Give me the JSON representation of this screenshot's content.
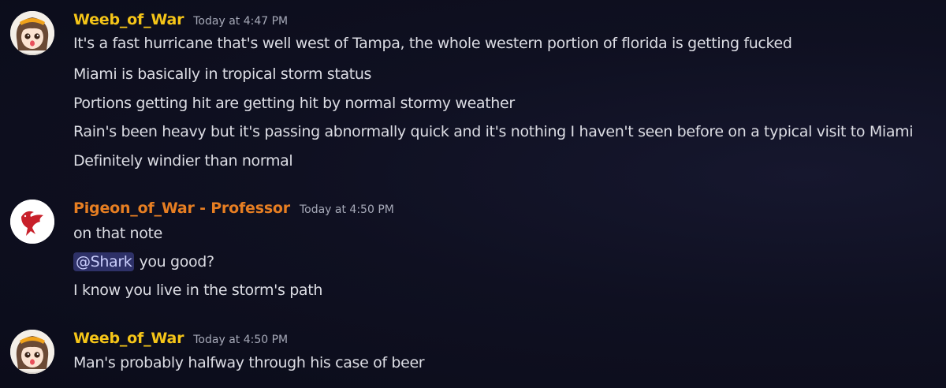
{
  "colors": {
    "weeb_name": "#f5c518",
    "pigeon_name": "#e67e22",
    "mention_bg": "#2e3168",
    "mention_text": "#c9cdfb"
  },
  "messages": [
    {
      "avatar_icon": "anime-girl-avatar-icon",
      "username": "Weeb_of_War",
      "timestamp": "Today at 4:47 PM",
      "lines": [
        "It's a fast hurricane that's well west of Tampa, the whole western portion of florida is getting fucked",
        "Miami is basically in tropical storm status",
        "Portions getting hit are getting hit by normal stormy weather",
        "Rain's been heavy but it's passing abnormally quick and it's nothing I haven't seen before on a typical visit to Miami",
        "Definitely windier than normal"
      ]
    },
    {
      "avatar_icon": "red-pigeon-avatar-icon",
      "username": "Pigeon_of_War - Professor",
      "timestamp": "Today at 4:50 PM",
      "lines": [
        "on that note",
        "you good?",
        "I know you live in the storm's path"
      ],
      "mention": "@Shark"
    },
    {
      "avatar_icon": "anime-girl-avatar-icon",
      "username": "Weeb_of_War",
      "timestamp": "Today at 4:50 PM",
      "lines": [
        "Man's probably halfway through his case of beer"
      ]
    }
  ]
}
